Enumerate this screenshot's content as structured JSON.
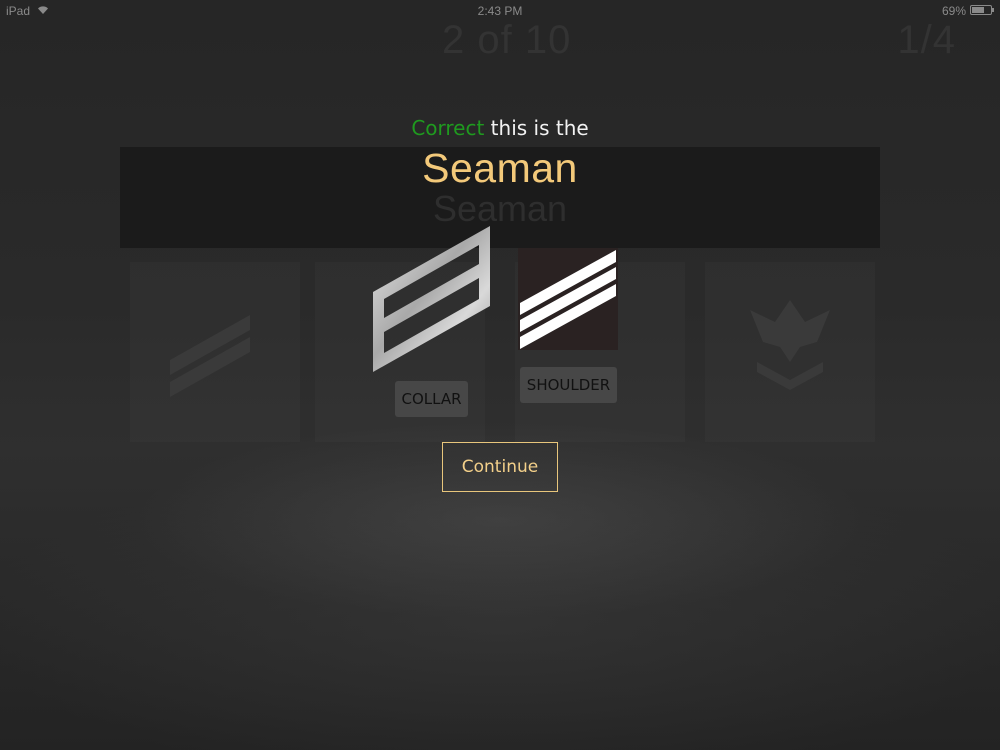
{
  "status_bar": {
    "device": "iPad",
    "time": "2:43 PM",
    "battery": "69%",
    "icons": [
      "wifi-icon",
      "battery-icon"
    ]
  },
  "background": {
    "progress": "2 of 10",
    "score": "1/4",
    "banner_title": "Seaman"
  },
  "result": {
    "status_word": "Correct",
    "message": " this is the",
    "rank_name": "Seaman"
  },
  "insignia": {
    "collar_label": "COLLAR",
    "shoulder_label": "SHOULDER"
  },
  "actions": {
    "continue_label": "Continue"
  },
  "colors": {
    "correct": "#1f9a1f",
    "rank_title": "#f3c97a",
    "button_border": "#e8c67c"
  }
}
